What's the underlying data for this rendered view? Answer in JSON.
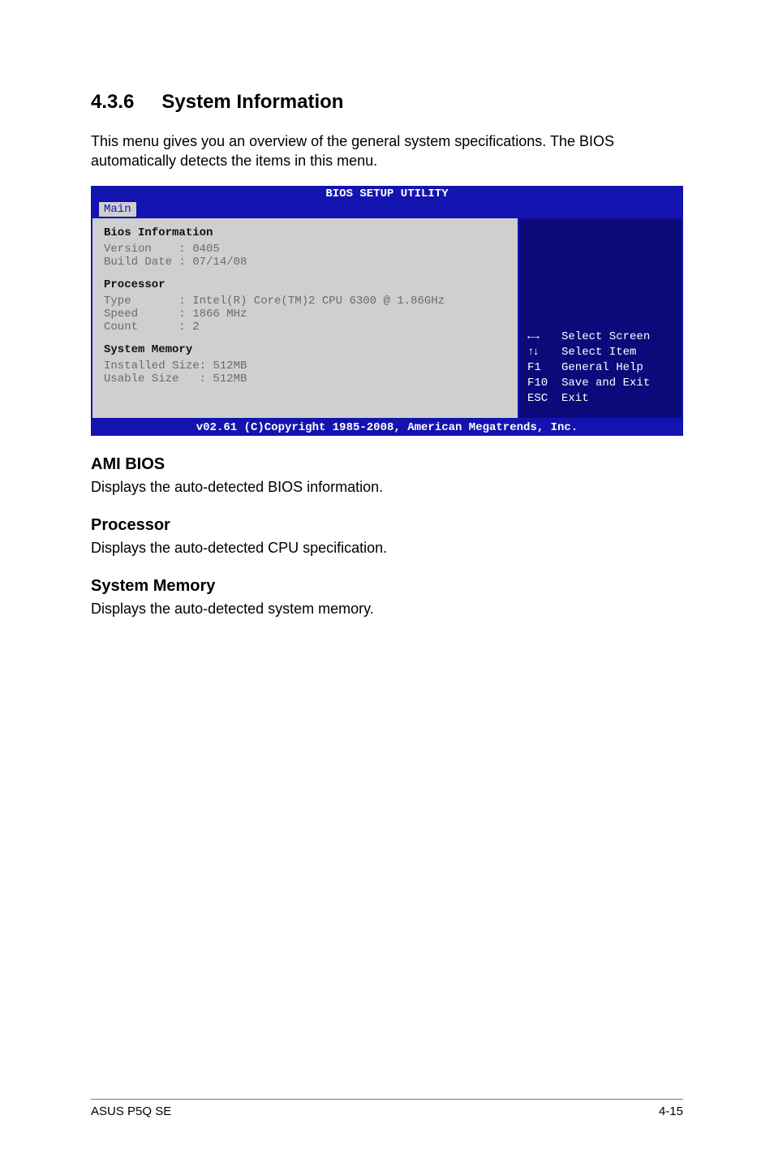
{
  "section": {
    "number": "4.3.6",
    "title": "System Information"
  },
  "intro": "This menu gives you an overview of the general system specifications. The BIOS automatically detects the items in this menu.",
  "bios": {
    "titlebar": "BIOS SETUP UTILITY",
    "tab": "Main",
    "left": {
      "bios_info_hdr": "Bios Information",
      "version_row": "Version    : 0405",
      "builddate_row": "Build Date : 07/14/08",
      "processor_hdr": "Processor",
      "type_row": "Type       : Intel(R) Core(TM)2 CPU 6300 @ 1.86GHz",
      "speed_row": "Speed      : 1866 MHz",
      "count_row": "Count      : 2",
      "sysmem_hdr": "System Memory",
      "installed_row": "Installed Size: 512MB",
      "usable_row": "Usable Size   : 512MB"
    },
    "right": {
      "help_select_screen": "Select Screen",
      "help_select_item": "Select Item",
      "help_f1_key": "F1",
      "help_f1_txt": "General Help",
      "help_f10_key": "F10",
      "help_f10_txt": "Save and Exit",
      "help_esc_key": "ESC",
      "help_esc_txt": "Exit"
    },
    "footer": "v02.61 (C)Copyright 1985-2008, American Megatrends, Inc."
  },
  "subs": {
    "ami_hdr": "AMI BIOS",
    "ami_txt": "Displays the auto-detected BIOS information.",
    "proc_hdr": "Processor",
    "proc_txt": "Displays the auto-detected CPU specification.",
    "mem_hdr": "System Memory",
    "mem_txt": "Displays the auto-detected system memory."
  },
  "footer": {
    "left": "ASUS P5Q SE",
    "right": "4-15"
  },
  "chart_data": {
    "type": "table",
    "title": "BIOS SETUP UTILITY — Main — System Information",
    "sections": [
      {
        "name": "Bios Information",
        "rows": [
          {
            "label": "Version",
            "value": "0405"
          },
          {
            "label": "Build Date",
            "value": "07/14/08"
          }
        ]
      },
      {
        "name": "Processor",
        "rows": [
          {
            "label": "Type",
            "value": "Intel(R) Core(TM)2 CPU 6300 @ 1.86GHz"
          },
          {
            "label": "Speed",
            "value": "1866 MHz"
          },
          {
            "label": "Count",
            "value": "2"
          }
        ]
      },
      {
        "name": "System Memory",
        "rows": [
          {
            "label": "Installed Size",
            "value": "512MB"
          },
          {
            "label": "Usable Size",
            "value": "512MB"
          }
        ]
      }
    ],
    "legend": [
      {
        "key": "←→",
        "action": "Select Screen"
      },
      {
        "key": "↑↓",
        "action": "Select Item"
      },
      {
        "key": "F1",
        "action": "General Help"
      },
      {
        "key": "F10",
        "action": "Save and Exit"
      },
      {
        "key": "ESC",
        "action": "Exit"
      }
    ],
    "footer": "v02.61 (C)Copyright 1985-2008, American Megatrends, Inc."
  }
}
